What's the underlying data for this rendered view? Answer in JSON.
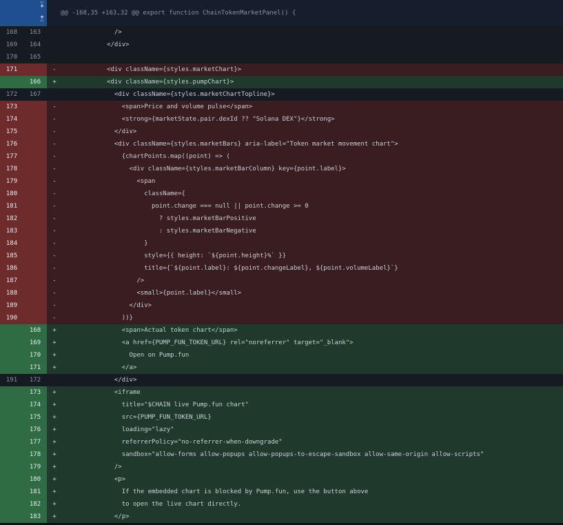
{
  "hunk": {
    "header": "@@ -168,35 +163,32 @@ export function ChainTokenMarketPanel() {",
    "expand_down_icon": "fold-down-icon",
    "expand_up_icon": "fold-up-icon"
  },
  "lines": [
    {
      "type": "ctx",
      "old": "168",
      "new": "163",
      "sign": "",
      "indent": "            ",
      "text": "/>"
    },
    {
      "type": "ctx",
      "old": "169",
      "new": "164",
      "sign": "",
      "indent": "          ",
      "text": "</div>"
    },
    {
      "type": "ctx",
      "old": "170",
      "new": "165",
      "sign": "",
      "indent": "",
      "text": ""
    },
    {
      "type": "del",
      "old": "171",
      "new": "",
      "sign": "-",
      "indent": "          ",
      "text": "<div className={styles.marketChart}>"
    },
    {
      "type": "add",
      "old": "",
      "new": "166",
      "sign": "+",
      "indent": "          ",
      "text": "<div className={styles.pumpChart}>"
    },
    {
      "type": "ctx",
      "old": "172",
      "new": "167",
      "sign": "",
      "indent": "            ",
      "text": "<div className={styles.marketChartTopline}>"
    },
    {
      "type": "del",
      "old": "173",
      "new": "",
      "sign": "-",
      "indent": "              ",
      "text": "<span>Price and volume pulse</span>"
    },
    {
      "type": "del",
      "old": "174",
      "new": "",
      "sign": "-",
      "indent": "              ",
      "text": "<strong>{marketState.pair.dexId ?? \"Solana DEX\"}</strong>"
    },
    {
      "type": "del",
      "old": "175",
      "new": "",
      "sign": "-",
      "indent": "            ",
      "text": "</div>"
    },
    {
      "type": "del",
      "old": "176",
      "new": "",
      "sign": "-",
      "indent": "            ",
      "text": "<div className={styles.marketBars} aria-label=\"Token market movement chart\">"
    },
    {
      "type": "del",
      "old": "177",
      "new": "",
      "sign": "-",
      "indent": "              ",
      "text": "{chartPoints.map((point) => ("
    },
    {
      "type": "del",
      "old": "178",
      "new": "",
      "sign": "-",
      "indent": "                ",
      "text": "<div className={styles.marketBarColumn} key={point.label}>"
    },
    {
      "type": "del",
      "old": "179",
      "new": "",
      "sign": "-",
      "indent": "                  ",
      "text": "<span"
    },
    {
      "type": "del",
      "old": "180",
      "new": "",
      "sign": "-",
      "indent": "                    ",
      "text": "className={"
    },
    {
      "type": "del",
      "old": "181",
      "new": "",
      "sign": "-",
      "indent": "                      ",
      "text": "point.change === null || point.change >= 0"
    },
    {
      "type": "del",
      "old": "182",
      "new": "",
      "sign": "-",
      "indent": "                        ",
      "text": "? styles.marketBarPositive"
    },
    {
      "type": "del",
      "old": "183",
      "new": "",
      "sign": "-",
      "indent": "                        ",
      "text": ": styles.marketBarNegative"
    },
    {
      "type": "del",
      "old": "184",
      "new": "",
      "sign": "-",
      "indent": "                    ",
      "text": "}"
    },
    {
      "type": "del",
      "old": "185",
      "new": "",
      "sign": "-",
      "indent": "                    ",
      "text": "style={{ height: `${point.height}%` }}"
    },
    {
      "type": "del",
      "old": "186",
      "new": "",
      "sign": "-",
      "indent": "                    ",
      "text": "title={`${point.label}: ${point.changeLabel}, ${point.volumeLabel}`}"
    },
    {
      "type": "del",
      "old": "187",
      "new": "",
      "sign": "-",
      "indent": "                  ",
      "text": "/>"
    },
    {
      "type": "del",
      "old": "188",
      "new": "",
      "sign": "-",
      "indent": "                  ",
      "text": "<small>{point.label}</small>"
    },
    {
      "type": "del",
      "old": "189",
      "new": "",
      "sign": "-",
      "indent": "                ",
      "text": "</div>"
    },
    {
      "type": "del",
      "old": "190",
      "new": "",
      "sign": "-",
      "indent": "              ",
      "text": "))}"
    },
    {
      "type": "add",
      "old": "",
      "new": "168",
      "sign": "+",
      "indent": "              ",
      "text": "<span>Actual token chart</span>"
    },
    {
      "type": "add",
      "old": "",
      "new": "169",
      "sign": "+",
      "indent": "              ",
      "text": "<a href={PUMP_FUN_TOKEN_URL} rel=\"noreferrer\" target=\"_blank\">"
    },
    {
      "type": "add",
      "old": "",
      "new": "170",
      "sign": "+",
      "indent": "                ",
      "text": "Open on Pump.fun"
    },
    {
      "type": "add",
      "old": "",
      "new": "171",
      "sign": "+",
      "indent": "              ",
      "text": "</a>"
    },
    {
      "type": "ctx",
      "old": "191",
      "new": "172",
      "sign": "",
      "indent": "            ",
      "text": "</div>"
    },
    {
      "type": "add",
      "old": "",
      "new": "173",
      "sign": "+",
      "indent": "            ",
      "text": "<iframe"
    },
    {
      "type": "add",
      "old": "",
      "new": "174",
      "sign": "+",
      "indent": "              ",
      "text": "title=\"$CHAIN live Pump.fun chart\""
    },
    {
      "type": "add",
      "old": "",
      "new": "175",
      "sign": "+",
      "indent": "              ",
      "text": "src={PUMP_FUN_TOKEN_URL}"
    },
    {
      "type": "add",
      "old": "",
      "new": "176",
      "sign": "+",
      "indent": "              ",
      "text": "loading=\"lazy\""
    },
    {
      "type": "add",
      "old": "",
      "new": "177",
      "sign": "+",
      "indent": "              ",
      "text": "referrerPolicy=\"no-referrer-when-downgrade\""
    },
    {
      "type": "add",
      "old": "",
      "new": "178",
      "sign": "+",
      "indent": "              ",
      "text": "sandbox=\"allow-forms allow-popups allow-popups-to-escape-sandbox allow-same-origin allow-scripts\""
    },
    {
      "type": "add",
      "old": "",
      "new": "179",
      "sign": "+",
      "indent": "            ",
      "text": "/>"
    },
    {
      "type": "add",
      "old": "",
      "new": "180",
      "sign": "+",
      "indent": "            ",
      "text": "<p>"
    },
    {
      "type": "add",
      "old": "",
      "new": "181",
      "sign": "+",
      "indent": "              ",
      "text": "If the embedded chart is blocked by Pump.fun, use the button above"
    },
    {
      "type": "add",
      "old": "",
      "new": "182",
      "sign": "+",
      "indent": "              ",
      "text": "to open the live chart directly."
    },
    {
      "type": "add",
      "old": "",
      "new": "183",
      "sign": "+",
      "indent": "            ",
      "text": "</p>"
    }
  ],
  "highlights": {
    "del_word": "marketChart",
    "add_word": "pumpChart"
  },
  "colors": {
    "bg": "#0d1117",
    "context": "#161b22",
    "deleted": "#3a1d20",
    "deleted_gutter": "#6e2b2c",
    "added": "#1f3a2c",
    "added_gutter": "#2f6b43",
    "hunk_gutter": "#1f4f8f"
  }
}
